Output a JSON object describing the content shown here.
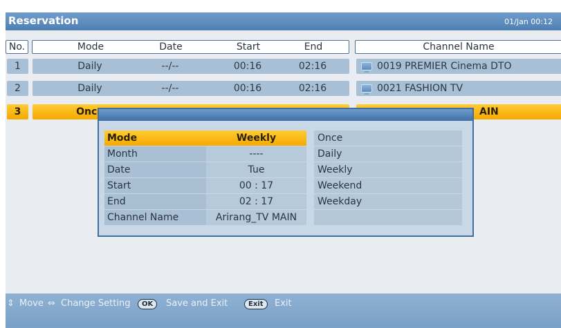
{
  "header": {
    "title": "Reservation",
    "clock": "01/Jan 00:12"
  },
  "columns": {
    "no": "No.",
    "mode": "Mode",
    "date": "Date",
    "start": "Start",
    "end": "End",
    "channel": "Channel Name"
  },
  "rows": [
    {
      "no": "1",
      "mode": "Daily",
      "date": "--/--",
      "start": "00:16",
      "end": "02:16",
      "channel": "0019 PREMIER Cinema DTO"
    },
    {
      "no": "2",
      "mode": "Daily",
      "date": "--/--",
      "start": "00:16",
      "end": "02:16",
      "channel": "0021 FASHION TV"
    },
    {
      "no": "3",
      "mode": "Once",
      "channel_visible": "AIN"
    }
  ],
  "popup": {
    "fields": [
      {
        "label": "Mode",
        "value": "Weekly"
      },
      {
        "label": "Month",
        "value": "----"
      },
      {
        "label": "Date",
        "value": "Tue"
      },
      {
        "label": "Start",
        "value": "00 : 17"
      },
      {
        "label": "End",
        "value": "02 : 17"
      },
      {
        "label": "Channel Name",
        "value": "Arirang_TV MAIN"
      }
    ],
    "options": [
      "Once",
      "Daily",
      "Weekly",
      "Weekend",
      "Weekday",
      ""
    ]
  },
  "footer": {
    "move": "Move",
    "change": "Change Setting",
    "ok_key": "OK",
    "save_exit": "Save and Exit",
    "exit_key": "Exit",
    "exit": "Exit"
  },
  "colors": {
    "accent": "#f5a800",
    "title_bar": "#4f7fb2",
    "row": "#a8c0d5"
  }
}
